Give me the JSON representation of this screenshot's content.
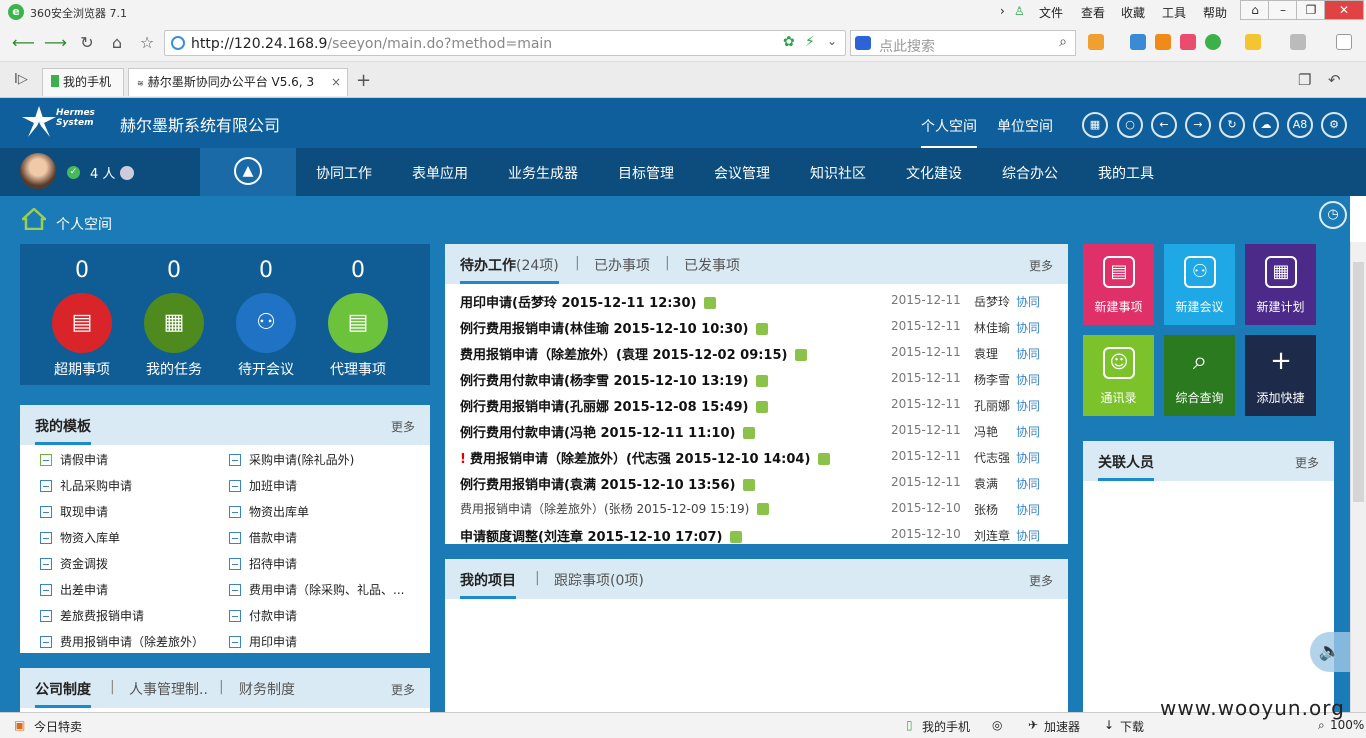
{
  "browser": {
    "title": "360安全浏览器 7.1",
    "menu": [
      "文件",
      "查看",
      "收藏",
      "工具",
      "帮助"
    ],
    "url_host": "http://120.24.168.9",
    "url_path": "/seeyon/main.do?method=main",
    "search_placeholder": "点此搜索",
    "tabs": [
      "我的手机",
      "赫尔墨斯协同办公平台 V5.6, 3"
    ],
    "status": {
      "left": "今日特卖",
      "phone": "我的手机",
      "accel": "加速器",
      "download": "下载",
      "zoom": "100%"
    }
  },
  "app": {
    "logo_line1": "Hermes",
    "logo_line2": "System",
    "company": "赫尔墨斯系统有限公司",
    "space_tabs": [
      "个人空间",
      "单位空间"
    ],
    "header_icons": [
      "grid-icon",
      "search-icon",
      "back-icon",
      "forward-icon",
      "refresh-icon",
      "cloud-icon",
      "a8-icon",
      "settings-icon"
    ],
    "a8_label": "A8",
    "online_count": "4 人",
    "nav": [
      "协同工作",
      "表单应用",
      "业务生成器",
      "目标管理",
      "会议管理",
      "知识社区",
      "文化建设",
      "综合办公",
      "我的工具"
    ]
  },
  "breadcrumb": "个人空间",
  "stats": [
    {
      "value": "0",
      "label": "超期事项",
      "color": "#d9252a"
    },
    {
      "value": "0",
      "label": "我的任务",
      "color": "#4f8a1f"
    },
    {
      "value": "0",
      "label": "待开会议",
      "color": "#1f72c4"
    },
    {
      "value": "0",
      "label": "代理事项",
      "color": "#6cc23a"
    }
  ],
  "templates": {
    "title": "我的模板",
    "more": "更多",
    "items": [
      "请假申请",
      "采购申请(除礼品外)",
      "礼品采购申请",
      "加班申请",
      "取现申请",
      "物资出库单",
      "物资入库单",
      "借款申请",
      "资金调拨",
      "招待申请",
      "出差申请",
      "费用申请（除采购、礼品、...",
      "差旅费报销申请",
      "付款申请",
      "费用报销申请（除差旅外）",
      "用印申请"
    ]
  },
  "policy": {
    "tabs": [
      "公司制度",
      "人事管理制..",
      "财务制度"
    ],
    "more": "更多"
  },
  "todo": {
    "tab1": "待办工作",
    "tab1_count": "(24项)",
    "tab2": "已办事项",
    "tab3": "已发事项",
    "more": "更多",
    "rows": [
      {
        "title": "用印申请(岳梦玲 2015-12-11 12:30)",
        "date": "2015-12-11",
        "person": "岳梦玲",
        "type": "协同",
        "bold": true,
        "urgent": false
      },
      {
        "title": "例行费用报销申请(林佳瑜 2015-12-10 10:30)",
        "date": "2015-12-11",
        "person": "林佳瑜",
        "type": "协同",
        "bold": true,
        "urgent": false
      },
      {
        "title": "费用报销申请（除差旅外）(袁理 2015-12-02 09:15)",
        "date": "2015-12-11",
        "person": "袁理",
        "type": "协同",
        "bold": true,
        "urgent": false
      },
      {
        "title": "例行费用付款申请(杨李雪 2015-12-10 13:19)",
        "date": "2015-12-11",
        "person": "杨李雪",
        "type": "协同",
        "bold": true,
        "urgent": false
      },
      {
        "title": "例行费用报销申请(孔丽娜 2015-12-08 15:49)",
        "date": "2015-12-11",
        "person": "孔丽娜",
        "type": "协同",
        "bold": true,
        "urgent": false
      },
      {
        "title": "例行费用付款申请(冯艳 2015-12-11 11:10)",
        "date": "2015-12-11",
        "person": "冯艳",
        "type": "协同",
        "bold": true,
        "urgent": false
      },
      {
        "title": "费用报销申请（除差旅外）(代志强 2015-12-10 14:04)",
        "date": "2015-12-11",
        "person": "代志强",
        "type": "协同",
        "bold": true,
        "urgent": true
      },
      {
        "title": "例行费用报销申请(袁满 2015-12-10 13:56)",
        "date": "2015-12-11",
        "person": "袁满",
        "type": "协同",
        "bold": true,
        "urgent": false
      },
      {
        "title": "费用报销申请（除差旅外）(张杨 2015-12-09 15:19)",
        "date": "2015-12-10",
        "person": "张杨",
        "type": "协同",
        "bold": false,
        "urgent": false
      },
      {
        "title": "申请额度调整(刘连章 2015-12-10 17:07)",
        "date": "2015-12-10",
        "person": "刘连章",
        "type": "协同",
        "bold": true,
        "urgent": false
      }
    ]
  },
  "projects": {
    "tab1": "我的项目",
    "tab2": "跟踪事项(0项)",
    "more": "更多"
  },
  "tiles": [
    {
      "label": "新建事项",
      "color": "#e0306a",
      "icon": "new-item-icon"
    },
    {
      "label": "新建会议",
      "color": "#1fa8e6",
      "icon": "new-meeting-icon"
    },
    {
      "label": "新建计划",
      "color": "#4b2a8a",
      "icon": "new-plan-icon"
    },
    {
      "label": "通讯录",
      "color": "#7cc22a",
      "icon": "contacts-icon"
    },
    {
      "label": "综合查询",
      "color": "#2b7a1f",
      "icon": "query-icon"
    },
    {
      "label": "添加快捷",
      "color": "#1e2a4a",
      "icon": "add-icon"
    }
  ],
  "related": {
    "title": "关联人员",
    "more": "更多"
  },
  "watermark": "www.wooyun.org"
}
